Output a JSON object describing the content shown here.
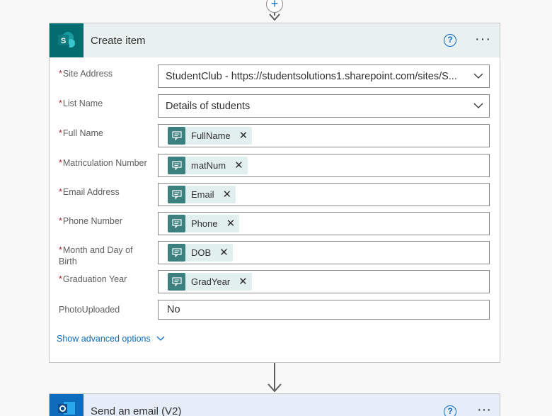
{
  "top_connector": {
    "add_label": "+"
  },
  "create_item": {
    "title": "Create item",
    "help_label": "?",
    "more_label": "···",
    "fields": [
      {
        "label": "Site Address",
        "required": true,
        "type": "dropdown",
        "value": "StudentClub - https://studentsolutions1.sharepoint.com/sites/S..."
      },
      {
        "label": "List Name",
        "required": true,
        "type": "dropdown",
        "value": "Details of students"
      },
      {
        "label": "Full Name",
        "required": true,
        "type": "token",
        "value": "FullName"
      },
      {
        "label": "Matriculation Number",
        "required": true,
        "type": "token",
        "value": "matNum"
      },
      {
        "label": "Email Address",
        "required": true,
        "type": "token",
        "value": "Email"
      },
      {
        "label": "Phone Number",
        "required": true,
        "type": "token",
        "value": "Phone"
      },
      {
        "label": "Month and Day of Birth",
        "required": true,
        "type": "token",
        "value": "DOB"
      },
      {
        "label": "Graduation Year",
        "required": true,
        "type": "token",
        "value": "GradYear"
      },
      {
        "label": "PhotoUploaded",
        "required": false,
        "type": "text",
        "value": "No"
      }
    ],
    "advanced_label": "Show advanced options"
  },
  "send_email": {
    "title": "Send an email (V2)",
    "help_label": "?",
    "more_label": "···"
  },
  "colors": {
    "sharepoint": "#036c70",
    "outlook": "#0f6cbd",
    "token_icon": "#3c8080",
    "required": "#a4262c",
    "link": "#0f6cbd"
  }
}
